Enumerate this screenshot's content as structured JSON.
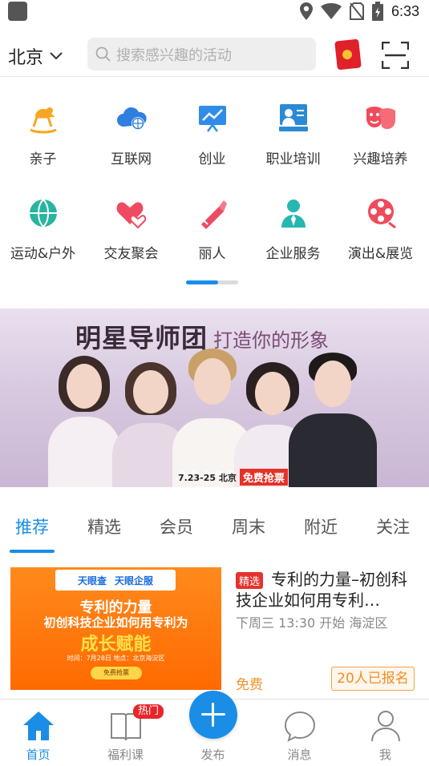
{
  "status_bar": {
    "time": "6:33",
    "icons": [
      "location-icon",
      "wifi-icon",
      "no-sim-icon",
      "battery-charging-icon"
    ]
  },
  "header": {
    "city": "北京",
    "search_placeholder": "搜索感兴趣的活动",
    "icons": [
      "red-packet-icon",
      "scan-icon"
    ]
  },
  "categories": [
    {
      "label": "亲子",
      "icon": "rocking-horse-icon",
      "color": "#f6a623"
    },
    {
      "label": "互联网",
      "icon": "cloud-globe-icon",
      "color": "#2f7fe0"
    },
    {
      "label": "创业",
      "icon": "chart-board-icon",
      "color": "#2f8ce8"
    },
    {
      "label": "职业培训",
      "icon": "lecture-icon",
      "color": "#2a8ad6"
    },
    {
      "label": "兴趣培养",
      "icon": "drama-masks-icon",
      "color": "#ee4b5c"
    },
    {
      "label": "运动&户外",
      "icon": "ball-icon",
      "color": "#27b5a0"
    },
    {
      "label": "交友聚会",
      "icon": "hearts-icon",
      "color": "#ee4b63"
    },
    {
      "label": "丽人",
      "icon": "lipstick-icon",
      "color": "#ee4b63"
    },
    {
      "label": "企业服务",
      "icon": "business-person-icon",
      "color": "#26b8b0"
    },
    {
      "label": "演出&展览",
      "icon": "film-reel-icon",
      "color": "#ee4b5c"
    }
  ],
  "category_pager": {
    "page": 1,
    "pages": 2
  },
  "banner": {
    "title": "明星导师团",
    "subtitle": "打造你的形象",
    "caption": "7.23-25 北京",
    "free_label": "免费抢票"
  },
  "tabs": [
    "推荐",
    "精选",
    "会员",
    "周末",
    "附近",
    "关注"
  ],
  "active_tab": 0,
  "events": [
    {
      "tag": "精选",
      "title": "专利的力量–初创科技企业如何用专利…",
      "time_place": "下周三 13:30 开始  海淀区",
      "price": "免费",
      "signup": "20人已报名",
      "thumb": {
        "logo_left": "天眼查",
        "logo_right": "天眼企服",
        "line1": "专利的力量",
        "line2": "初创科技企业如何用专利为",
        "line3": "成长赋能",
        "meta": "时间：7月28日  地点：北京海淀区",
        "button": "免费抢票"
      }
    }
  ],
  "bottom_nav": {
    "items": [
      {
        "label": "首页",
        "icon": "home-icon",
        "active": true
      },
      {
        "label": "福利课",
        "icon": "book-icon",
        "active": false
      },
      {
        "label": "发布",
        "icon": "plus-icon",
        "active": false
      },
      {
        "label": "消息",
        "icon": "chat-bubble-icon",
        "active": false
      },
      {
        "label": "我",
        "icon": "profile-icon",
        "active": false
      }
    ],
    "hot_badge": "热门"
  }
}
